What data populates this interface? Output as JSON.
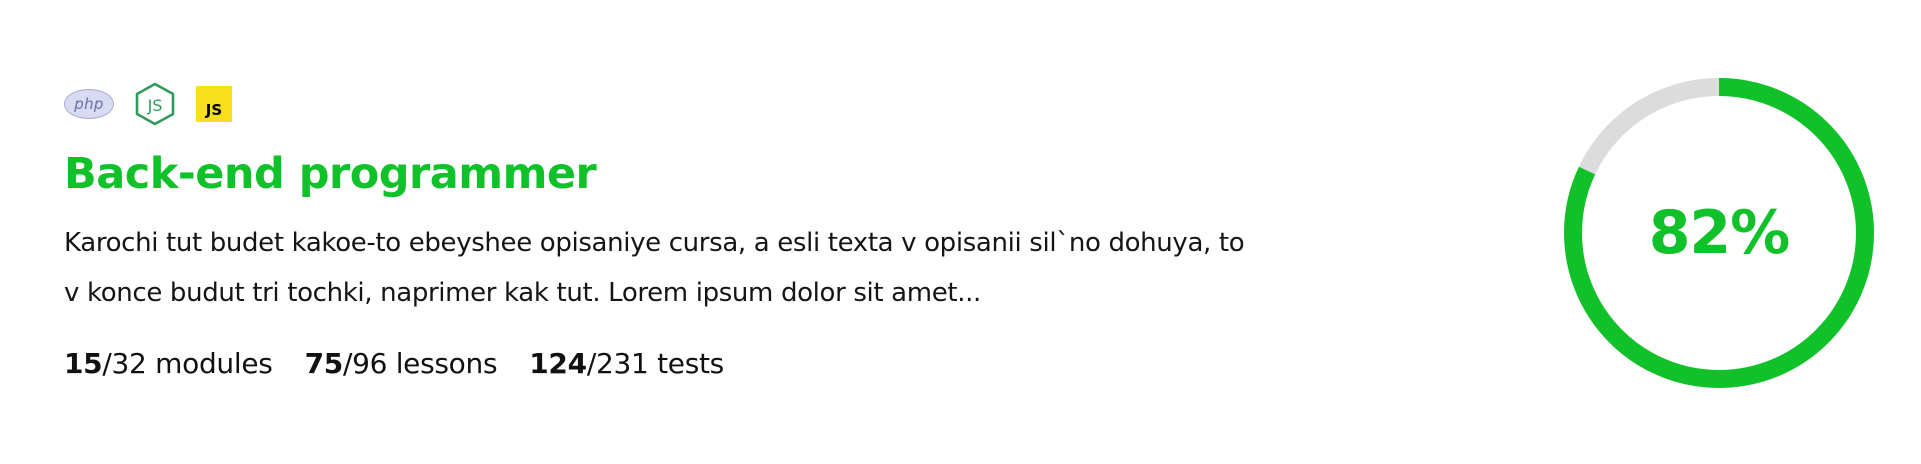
{
  "course": {
    "tech_icons": [
      {
        "name": "php-icon",
        "label": "php"
      },
      {
        "name": "nodejs-icon",
        "label": "JS"
      },
      {
        "name": "javascript-icon",
        "label": "JS"
      }
    ],
    "title": "Back-end programmer",
    "description": "Karochi tut budet kakoe-to ebeyshee opisaniye cursa, a esli texta v opisanii sil`no dohuya, to v konce budut tri tochki, naprimer kak tut. Lorem ipsum dolor sit amet...",
    "stats": {
      "modules": {
        "done": "15",
        "rest": "/32 modules"
      },
      "lessons": {
        "done": "75",
        "rest": "/96 lessons"
      },
      "tests": {
        "done": "124",
        "rest": "/231 tests"
      }
    },
    "progress": {
      "percent": 82,
      "label": "82%"
    }
  },
  "colors": {
    "accent": "#10c12a",
    "track": "#dcdcdc",
    "php_bg": "#d9dbf2",
    "node_green": "#2f9b5b",
    "js_yellow": "#f7df1e"
  }
}
